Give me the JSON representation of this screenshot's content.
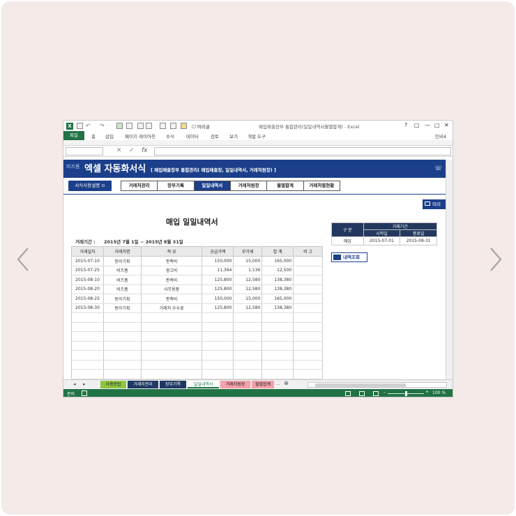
{
  "titlebar": {
    "window_title": "매입매출장부 통합관리(일일내역서월별합계) - Excel",
    "format_brush": "머리글",
    "controls": [
      "?",
      "□",
      "—",
      "□",
      "✕"
    ]
  },
  "ribbon": {
    "tabs": [
      "파일",
      "홈",
      "삽입",
      "페이지 레이아웃",
      "수식",
      "데이터",
      "검토",
      "보기",
      "개발 도구"
    ],
    "user": "인비4"
  },
  "formula_bar": {
    "fx": "fx",
    "cancel": "✕",
    "confirm": "✓"
  },
  "banner": {
    "brand": "비즈폼",
    "title": "엑셀 자동화서식",
    "subtitle": "[ 매입매출장부 통합관리( 매입매출장, 일일내역서, 거래처원장) ]"
  },
  "guide_button": "서식사용설명",
  "menu": [
    "거래처관리",
    "장부기록",
    "일일내역서",
    "거래처원장",
    "월별합계",
    "거래처별현황"
  ],
  "menu_active_index": 2,
  "preview_button": "미리",
  "document": {
    "title": "매입 일일내역서",
    "period_label": "거래기간 :",
    "period_value": "2015년 7월 1일  ~  2015년 8월 31일"
  },
  "ledger": {
    "headers": [
      "거래일자",
      "거래처명",
      "적 요",
      "공급가액",
      "부가세",
      "합 계",
      "비 고"
    ],
    "rows": [
      [
        "2015-07-10",
        "동아기획",
        "판촉비",
        "150,000",
        "15,000",
        "165,000",
        ""
      ],
      [
        "2015-07-25",
        "비즈폼",
        "광고비",
        "11,364",
        "1,136",
        "12,500",
        ""
      ],
      [
        "2015-08-10",
        "비즈폼",
        "판촉비",
        "125,800",
        "12,580",
        "138,380",
        ""
      ],
      [
        "2015-08-20",
        "비즈폼",
        "사무용품",
        "125,800",
        "12,580",
        "138,380",
        ""
      ],
      [
        "2015-08-25",
        "동아기획",
        "판촉비",
        "150,000",
        "15,000",
        "165,000",
        ""
      ],
      [
        "2015-08-30",
        "동아기획",
        "거래처 수수료",
        "125,800",
        "12,580",
        "138,380",
        ""
      ]
    ],
    "empty_rows": 8
  },
  "side_table": {
    "group_header": "구 분",
    "period_header": "거래기간",
    "start_header": "시작일",
    "end_header": "종료일",
    "type": "매입",
    "start": "2015-07-01",
    "end": "2015-08-31"
  },
  "query_button": "내역조회",
  "sheet_tabs": [
    {
      "label": "사용방법",
      "bg": "#8dc63f",
      "fg": "#1a1a1a"
    },
    {
      "label": "거래처관리",
      "bg": "#1f3864",
      "fg": "#ffffff"
    },
    {
      "label": "장부기록",
      "bg": "#1f3864",
      "fg": "#ffffff"
    },
    {
      "label": "일일내역서",
      "bg": "#ffffff",
      "fg": "#217346"
    },
    {
      "label": "거래처원장",
      "bg": "#f4a0a8",
      "fg": "#1a1a1a"
    },
    {
      "label": "월별합계",
      "bg": "#f4a0a8",
      "fg": "#1a1a1a"
    }
  ],
  "tab_more": "...",
  "tab_add": "⊕",
  "status": {
    "ready": "준비",
    "zoom": "100 %"
  },
  "colors": {
    "excel_green": "#217346",
    "banner_blue": "#1b3f8a",
    "header_navy": "#23385e"
  }
}
